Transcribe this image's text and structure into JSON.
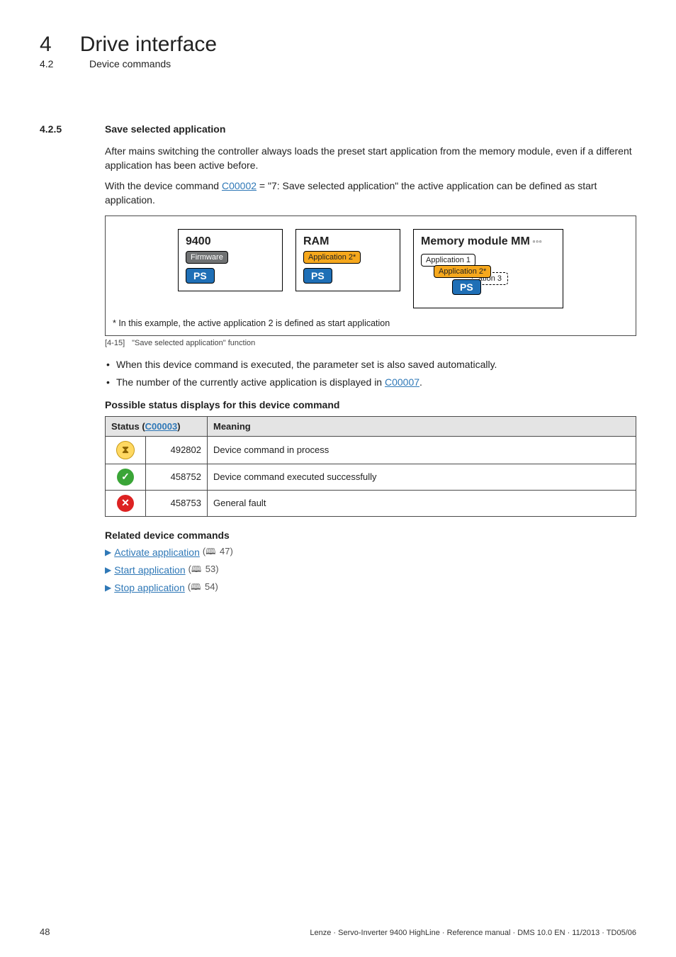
{
  "header": {
    "chapter_number": "4",
    "chapter_title": "Drive interface",
    "section_number": "4.2",
    "section_title": "Device commands"
  },
  "section": {
    "number": "4.2.5",
    "title": "Save selected application"
  },
  "paras": {
    "p1": "After mains switching the controller always loads the preset start application from the memory module, even if a different application has been active before.",
    "p2_pre": "With the device command ",
    "p2_link": "C00002",
    "p2_post": " = \"7: Save selected application\" the active application can be defined as start application."
  },
  "figure": {
    "box1": {
      "title": "9400",
      "chip": "Firmware",
      "ps": "PS"
    },
    "box2": {
      "title": "RAM",
      "chip": "Application 2*",
      "ps": "PS"
    },
    "box3": {
      "title": "Memory module MM",
      "app1": "Application 1",
      "app2": "Application 2*",
      "app3": "ation 3",
      "ps": "PS"
    },
    "note": "* In this example, the active application 2 is defined as start application",
    "caption_num": "[4-15]",
    "caption_text": "\"Save selected application\" function"
  },
  "bullets": {
    "b1": "When this device command is executed, the parameter set is also saved automatically.",
    "b2_pre": "The number of the currently active application is displayed in ",
    "b2_link": "C00007",
    "b2_post": "."
  },
  "status_block": {
    "heading": "Possible status displays for this device command",
    "th_status_pre": "Status (",
    "th_status_link": "C00003",
    "th_status_post": ")",
    "th_meaning": "Meaning",
    "rows": [
      {
        "code": "492802",
        "meaning": "Device command in process"
      },
      {
        "code": "458752",
        "meaning": "Device command executed successfully"
      },
      {
        "code": "458753",
        "meaning": "General fault"
      }
    ]
  },
  "related": {
    "heading": "Related device commands",
    "items": [
      {
        "label": "Activate application",
        "page": "47"
      },
      {
        "label": "Start application",
        "page": "53"
      },
      {
        "label": "Stop application",
        "page": "54"
      }
    ]
  },
  "footer": {
    "page": "48",
    "doc": "Lenze · Servo-Inverter 9400 HighLine · Reference manual · DMS 10.0 EN · 11/2013 · TD05/06"
  },
  "chart_data": {
    "type": "table",
    "title": "Possible status displays for this device command",
    "columns": [
      "Status (C00003)",
      "Meaning"
    ],
    "rows": [
      [
        "492802",
        "Device command in process"
      ],
      [
        "458752",
        "Device command executed successfully"
      ],
      [
        "458753",
        "General fault"
      ]
    ]
  }
}
